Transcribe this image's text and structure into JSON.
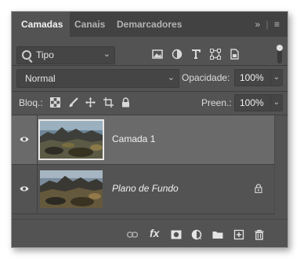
{
  "tabs": [
    {
      "label": "Camadas",
      "active": true
    },
    {
      "label": "Canais",
      "active": false
    },
    {
      "label": "Demarcadores",
      "active": false
    }
  ],
  "panel_menu": {
    "collapse_label": "»",
    "menu_label": "≡"
  },
  "filter": {
    "type_label": "Tipo"
  },
  "blend": {
    "mode": "Normal",
    "opacity_label": "Opacidade:",
    "opacity_value": "100%"
  },
  "lock": {
    "label": "Bloq.:",
    "fill_label": "Preen.:",
    "fill_value": "100%"
  },
  "layers": [
    {
      "name": "Camada 1",
      "selected": true,
      "italic": false,
      "locked": false
    },
    {
      "name": "Plano de Fundo",
      "selected": false,
      "italic": true,
      "locked": true
    }
  ],
  "footer": {
    "fx_label": "fx"
  },
  "colors": {
    "panel": "#535353",
    "tabbar": "#424242",
    "selected_row": "#6a6a6a"
  }
}
